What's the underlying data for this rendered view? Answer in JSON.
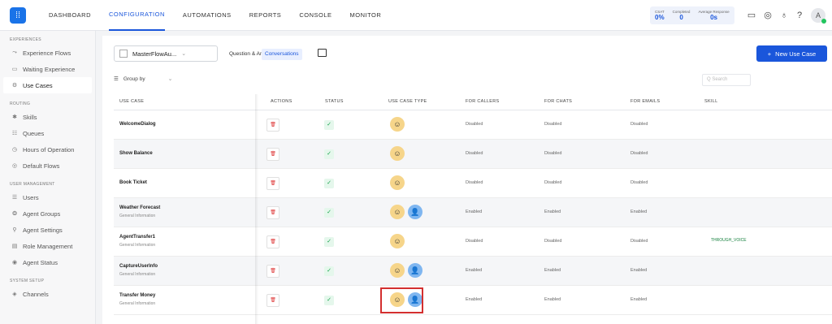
{
  "nav": {
    "items": [
      "DASHBOARD",
      "CONFIGURATION",
      "AUTOMATIONS",
      "REPORTS",
      "CONSOLE",
      "MONITOR"
    ],
    "active": "CONFIGURATION"
  },
  "metrics": [
    {
      "label": "CSAT",
      "value": "0%"
    },
    {
      "label": "Completed",
      "value": "0"
    },
    {
      "label": "Average Response",
      "value": "0s"
    }
  ],
  "user_avatar": "A",
  "sidebar": {
    "sections": [
      {
        "title": "EXPERIENCES",
        "items": [
          {
            "label": "Experience Flows",
            "icon": "flow-icon"
          },
          {
            "label": "Waiting Experience",
            "icon": "monitor-icon"
          },
          {
            "label": "Use Cases",
            "icon": "use-case-icon",
            "active": true
          }
        ]
      },
      {
        "title": "ROUTING",
        "items": [
          {
            "label": "Skills",
            "icon": "skills-icon"
          },
          {
            "label": "Queues",
            "icon": "queues-icon"
          },
          {
            "label": "Hours of Operation",
            "icon": "clock-icon"
          },
          {
            "label": "Default Flows",
            "icon": "default-flow-icon"
          }
        ]
      },
      {
        "title": "USER MANAGEMENT",
        "items": [
          {
            "label": "Users",
            "icon": "users-icon"
          },
          {
            "label": "Agent Groups",
            "icon": "agent-groups-icon"
          },
          {
            "label": "Agent Settings",
            "icon": "agent-settings-icon"
          },
          {
            "label": "Role Management",
            "icon": "role-icon"
          },
          {
            "label": "Agent Status",
            "icon": "status-icon"
          }
        ]
      },
      {
        "title": "SYSTEM SETUP",
        "items": [
          {
            "label": "Channels",
            "icon": "channels-icon"
          }
        ]
      }
    ]
  },
  "toolbar": {
    "app_select": "MasterFlowAu...",
    "tab_qa": "Question & Answers",
    "tab_conversations": "Conversations",
    "new_button": "New Use Case",
    "group_by": "Group by",
    "search_placeholder": "Q Search"
  },
  "table": {
    "columns": [
      "USE CASE",
      "ACTIONS",
      "STATUS",
      "USE CASE TYPE",
      "FOR CALLERS",
      "FOR CHATS",
      "FOR EMAILS",
      "SKILL"
    ],
    "rows": [
      {
        "name": "WelcomeDialog",
        "desc": "",
        "types": [
          "bot"
        ],
        "callers": "Disabled",
        "chats": "Disabled",
        "emails": "Disabled",
        "skill": ""
      },
      {
        "name": "Show Balance",
        "desc": "",
        "types": [
          "bot"
        ],
        "callers": "Disabled",
        "chats": "Disabled",
        "emails": "Disabled",
        "skill": ""
      },
      {
        "name": "Book Ticket",
        "desc": "",
        "types": [
          "bot"
        ],
        "callers": "Disabled",
        "chats": "Disabled",
        "emails": "Disabled",
        "skill": ""
      },
      {
        "name": "Weather Forecast",
        "desc": "General Information",
        "types": [
          "bot",
          "agent"
        ],
        "callers": "Enabled",
        "chats": "Enabled",
        "emails": "Enabled",
        "skill": ""
      },
      {
        "name": "AgentTransfer1",
        "desc": "General Information",
        "types": [
          "bot"
        ],
        "callers": "Disabled",
        "chats": "Disabled",
        "emails": "Disabled",
        "skill": "THROUGH_VOICE"
      },
      {
        "name": "CaptureUserInfo",
        "desc": "General Information",
        "types": [
          "bot",
          "agent"
        ],
        "callers": "Enabled",
        "chats": "Enabled",
        "emails": "Enabled",
        "skill": ""
      },
      {
        "name": "Transfer Money",
        "desc": "General Information",
        "types": [
          "bot",
          "agent"
        ],
        "callers": "Enabled",
        "chats": "Enabled",
        "emails": "Enabled",
        "skill": ""
      }
    ]
  }
}
